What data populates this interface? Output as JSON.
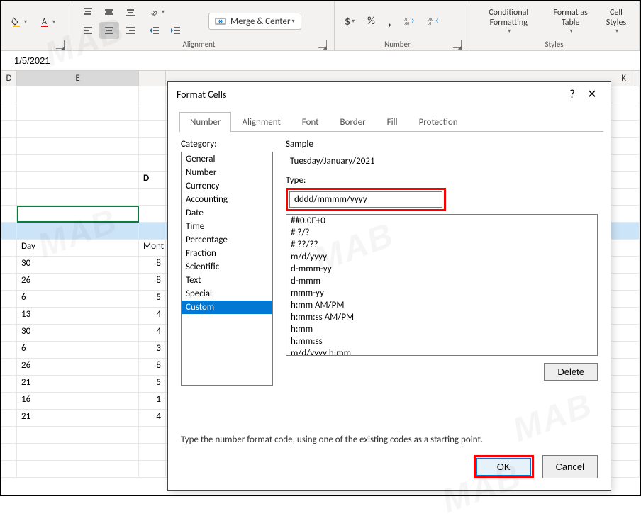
{
  "ribbon": {
    "merge_center": "Merge & Center",
    "alignment_label": "Alignment",
    "number_label": "Number",
    "styles_label": "Styles",
    "conditional_formatting": "Conditional Formatting",
    "format_as_table": "Format as Table",
    "cell_styles": "Cell Styles"
  },
  "formula_bar": {
    "value": "1/5/2021"
  },
  "columns": {
    "D": "D",
    "E": "E",
    "K": "K"
  },
  "table": {
    "headers": {
      "day": "Day",
      "month": "Mont"
    },
    "bold_D_char": "D",
    "rows": [
      {
        "day": "30",
        "month": "8"
      },
      {
        "day": "26",
        "month": "8"
      },
      {
        "day": "6",
        "month": "5"
      },
      {
        "day": "13",
        "month": "4"
      },
      {
        "day": "30",
        "month": "4"
      },
      {
        "day": "6",
        "month": "3"
      },
      {
        "day": "26",
        "month": "8"
      },
      {
        "day": "21",
        "month": "5"
      },
      {
        "day": "16",
        "month": "1"
      },
      {
        "day": "21",
        "month": "4"
      }
    ]
  },
  "dialog": {
    "title": "Format Cells",
    "tabs": [
      "Number",
      "Alignment",
      "Font",
      "Border",
      "Fill",
      "Protection"
    ],
    "active_tab": "Number",
    "category_label": "Category:",
    "categories": [
      "General",
      "Number",
      "Currency",
      "Accounting",
      "Date",
      "Time",
      "Percentage",
      "Fraction",
      "Scientific",
      "Text",
      "Special",
      "Custom"
    ],
    "selected_category": "Custom",
    "sample_label": "Sample",
    "sample_value": "Tuesday/January/2021",
    "type_label": "Type:",
    "type_value": "dddd/mmmm/yyyy",
    "formats": [
      "##0.0E+0",
      "# ?/?",
      "# ??/??",
      "m/d/yyyy",
      "d-mmm-yy",
      "d-mmm",
      "mmm-yy",
      "h:mm AM/PM",
      "h:mm:ss AM/PM",
      "h:mm",
      "h:mm:ss",
      "m/d/yyyy h:mm"
    ],
    "delete_label": "Delete",
    "hint": "Type the number format code, using one of the existing codes as a starting point.",
    "ok_label": "OK",
    "cancel_label": "Cancel"
  },
  "watermark": "MAB"
}
